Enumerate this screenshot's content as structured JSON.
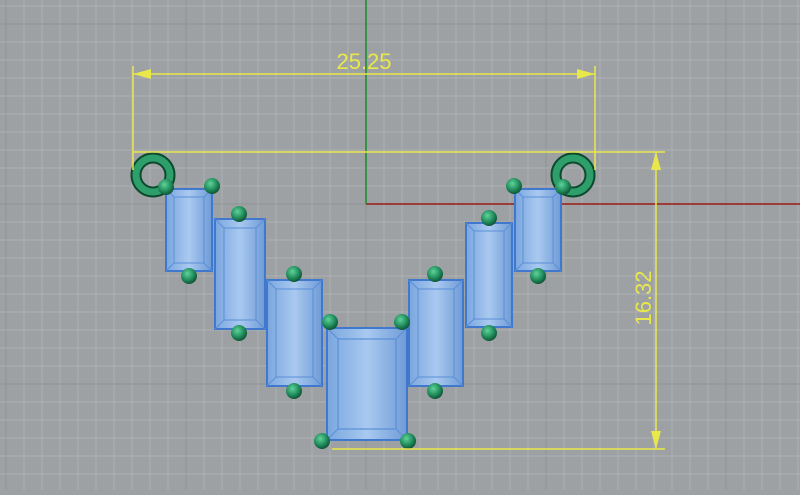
{
  "viewport": {
    "name": "perspective-viewport",
    "colors": {
      "background": "#9ea1a4",
      "grid_minor": "#aeb1b4",
      "grid_major": "#8f9295",
      "axis_x": "#9b1a14",
      "axis_y": "#1a8a2a",
      "dimension": "#e8e84a",
      "gem_fill": "#8fb6e6",
      "gem_edge": "#4f86d6",
      "prong": "#1f8a5a",
      "prong_dark": "#0d4a2e"
    }
  },
  "dimensions": {
    "width_label": "25.25",
    "height_label": "16.32"
  }
}
